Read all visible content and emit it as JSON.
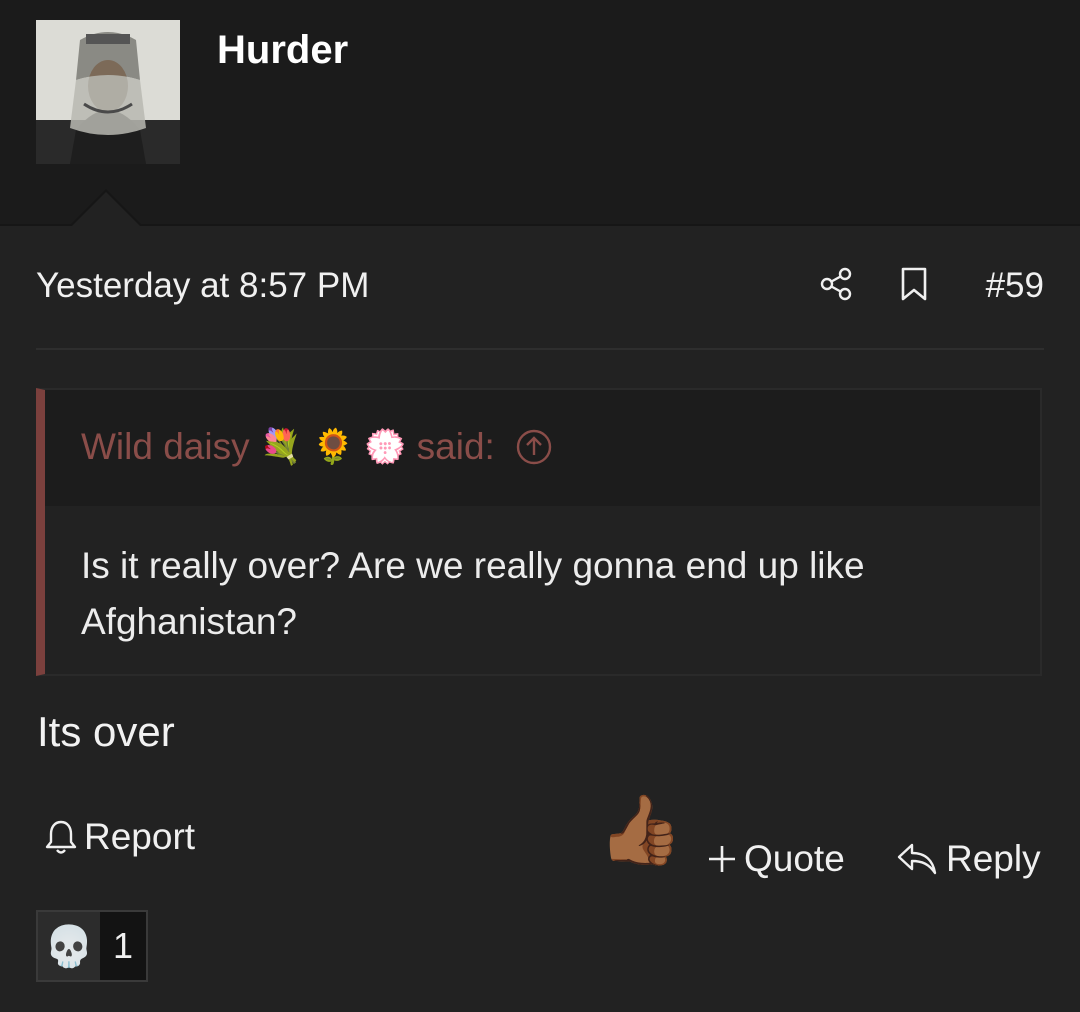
{
  "header": {
    "username": "Hurder",
    "avatar_icon": "user-avatar-photo"
  },
  "post": {
    "timestamp": "Yesterday at 8:57 PM",
    "number": "#59",
    "share_icon": "share-icon",
    "bookmark_icon": "bookmark-icon",
    "quote": {
      "author": "Wild daisy",
      "emoji_1": "💐",
      "emoji_2": "🌻",
      "emoji_3": "💮",
      "said": "said:",
      "text": "Is it really over? Are we really gonna end up like Afghanistan?",
      "accent_color": "#7b403d"
    },
    "body": "Its over"
  },
  "actions": {
    "report": "Report",
    "like_emoji": "👍🏾",
    "quote": "Quote",
    "reply": "Reply"
  },
  "reactions": [
    {
      "emoji": "💀",
      "count": "1"
    }
  ]
}
